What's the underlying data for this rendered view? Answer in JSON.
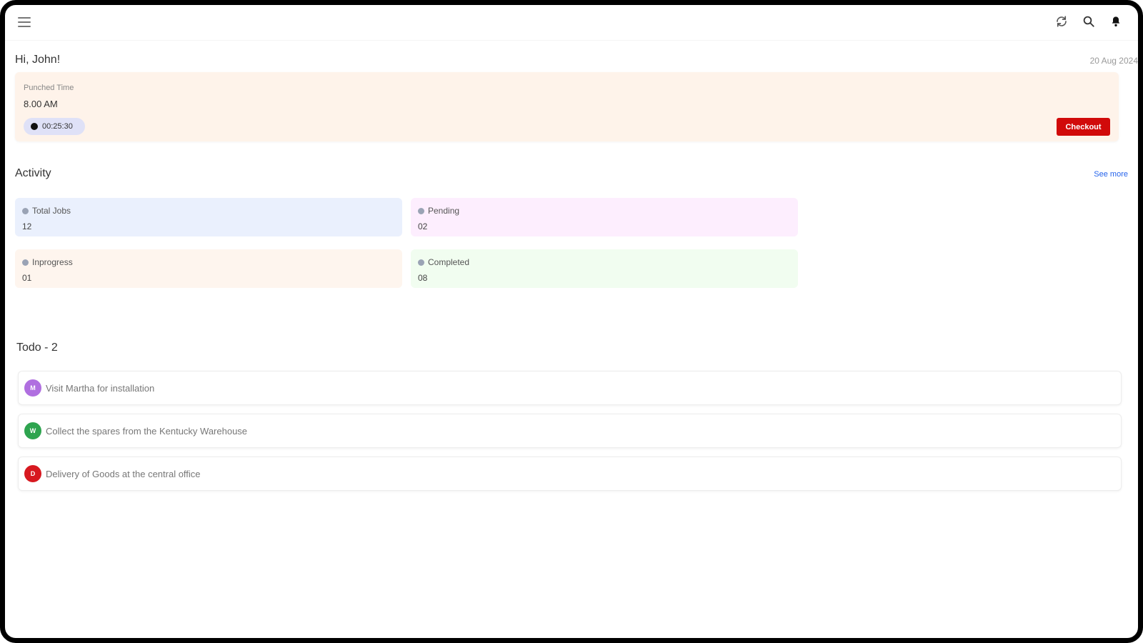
{
  "header": {
    "icons": [
      "menu-icon",
      "refresh-icon",
      "search-icon",
      "bell-icon"
    ]
  },
  "greeting": "Hi, John!",
  "date": "20 Aug 2024",
  "punch": {
    "label": "Punched Time",
    "time": "8.00 AM",
    "timer": "00:25:30",
    "checkout_label": "Checkout"
  },
  "activity": {
    "title": "Activity",
    "see_more": "See more",
    "stats": [
      {
        "label": "Total  Jobs",
        "value": "12",
        "bg": "#eaf0fd"
      },
      {
        "label": "Pending",
        "value": "02",
        "bg": "#fdeefe"
      },
      {
        "label": "Inprogress",
        "value": "01",
        "bg": "#fef5ee"
      },
      {
        "label": "Completed",
        "value": "08",
        "bg": "#f1fdf0"
      }
    ]
  },
  "todo": {
    "title": "Todo - 2",
    "items": [
      {
        "text": "Visit Martha for installation",
        "avatar": "M",
        "color": "#b06fe0"
      },
      {
        "text": "Collect the spares from the Kentucky Warehouse",
        "avatar": "W",
        "color": "#2ea44f"
      },
      {
        "text": "Delivery of Goods at the central office",
        "avatar": "D",
        "color": "#d71920"
      }
    ]
  },
  "colors": {
    "punch_card_bg": "#fef3ea",
    "checkout": "#d10a0a",
    "link": "#2563eb"
  }
}
